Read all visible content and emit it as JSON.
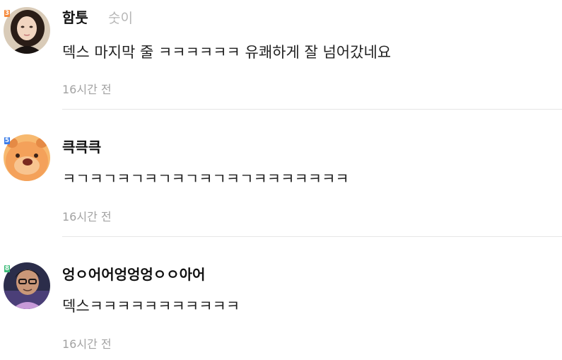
{
  "comments": [
    {
      "nickname": "함툿",
      "level": "3",
      "level_color": "#f5893b",
      "sub_label": "숫이",
      "text": "덱스 마지막 줄 ㅋㅋㅋㅋㅋㅋ 유쾌하게 잘 넘어갔네요",
      "time": "16시간 전",
      "avatar_icon": "woman-portrait-icon"
    },
    {
      "nickname": "큭큭큭",
      "level": "5",
      "level_color": "#3b7de8",
      "text": "ㅋㄱㅋㄱㅋㄱㅋㄱㅋㄱㅋㄱㅋㄱㅋㅋㅋㅋㅋㅋㅋ",
      "time": "16시간 전",
      "avatar_icon": "cartoon-animal-icon"
    },
    {
      "nickname": "엉ㅇ어어엉엉엉ㅇㅇ아어",
      "level": "8",
      "level_color": "#3dbb79",
      "text": "덱스ㅋㅋㅋㅋㅋㅋㅋㅋㅋㅋㅋ",
      "time": "16시간 전",
      "avatar_icon": "man-portrait-icon"
    }
  ]
}
